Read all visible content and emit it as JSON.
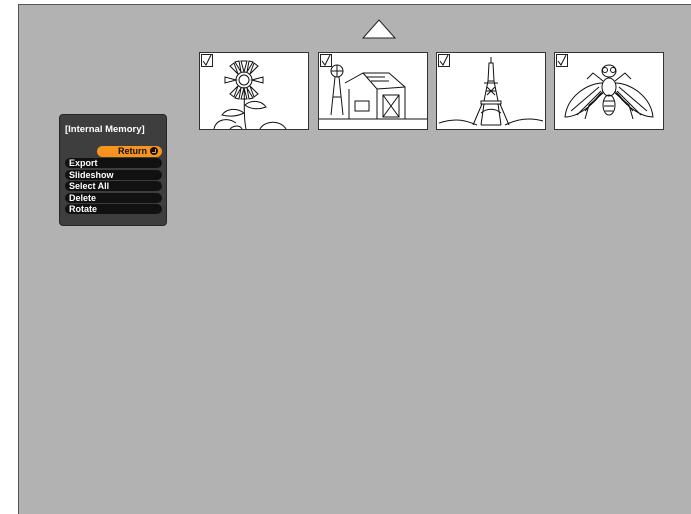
{
  "menu": {
    "title": "[Internal Memory]",
    "items": [
      {
        "label": "Return",
        "selected": true,
        "icon": "enter-icon"
      },
      {
        "label": "Export"
      },
      {
        "label": "Slideshow"
      },
      {
        "label": "Select All"
      },
      {
        "label": "Delete"
      },
      {
        "label": "Rotate"
      }
    ]
  },
  "thumbnails": [
    {
      "subject": "sunflower",
      "checked": true
    },
    {
      "subject": "barn-windmill",
      "checked": true
    },
    {
      "subject": "eiffel-tower",
      "checked": true
    },
    {
      "subject": "fly",
      "checked": true
    }
  ],
  "navigation": {
    "icon": "triangle-up-icon"
  },
  "colors": {
    "background": "#b2b2b2",
    "highlight": "#f7941d",
    "menu": "#3e3e3e"
  }
}
